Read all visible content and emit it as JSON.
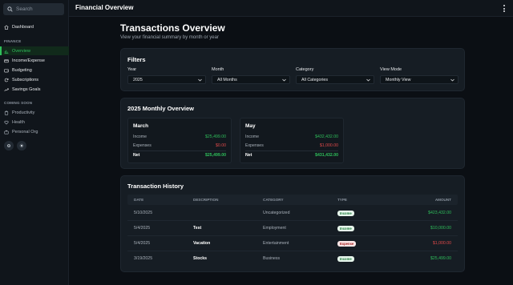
{
  "search": {
    "placeholder": "Search"
  },
  "sidebar": {
    "dashboard": "Dashboard",
    "finance_heading": "FINANCE",
    "finance_items": [
      "Overview",
      "Income/Expense",
      "Budgeting",
      "Subscriptions",
      "Savings Goals"
    ],
    "coming_soon_heading": "COMING SOON",
    "coming_soon_items": [
      "Productivity",
      "Health",
      "Personal Org"
    ]
  },
  "header": {
    "title": "Financial Overview"
  },
  "page": {
    "title": "Transactions Overview",
    "subtitle": "View your financial summary by month or year"
  },
  "filters": {
    "title": "Filters",
    "year": {
      "label": "Year",
      "value": "2025"
    },
    "month": {
      "label": "Month",
      "value": "All Months"
    },
    "category": {
      "label": "Category",
      "value": "All Categories"
    },
    "view_mode": {
      "label": "View Mode",
      "value": "Monthly View"
    }
  },
  "monthly": {
    "title": "2025 Monthly Overview",
    "months": [
      {
        "name": "March",
        "income_label": "Income",
        "income": "$25,499.00",
        "expenses_label": "Expenses",
        "expenses": "$0.00",
        "net_label": "Net",
        "net": "$25,499.00"
      },
      {
        "name": "May",
        "income_label": "Income",
        "income": "$432,432.00",
        "expenses_label": "Expenses",
        "expenses": "$1,000.00",
        "net_label": "Net",
        "net": "$431,432.00"
      }
    ]
  },
  "history": {
    "title": "Transaction History",
    "columns": {
      "date": "DATE",
      "description": "DESCRIPTION",
      "category": "CATEGORY",
      "type": "TYPE",
      "amount": "AMOUNT"
    },
    "rows": [
      {
        "date": "5/10/2025",
        "description": "",
        "category": "Uncategorized",
        "type": "Income",
        "amount": "$423,432.00"
      },
      {
        "date": "5/4/2025",
        "description": "Test",
        "category": "Employment",
        "type": "Income",
        "amount": "$10,000.00"
      },
      {
        "date": "5/4/2025",
        "description": "Vacation",
        "category": "Entertainment",
        "type": "Expense",
        "amount": "$1,000.00"
      },
      {
        "date": "3/19/2025",
        "description": "Stocks",
        "category": "Business",
        "type": "Income",
        "amount": "$25,499.00"
      }
    ]
  },
  "colors": {
    "accent": "#2fbf5b",
    "negative": "#e24a4a",
    "background": "#0b0f14",
    "card": "#161d24"
  }
}
